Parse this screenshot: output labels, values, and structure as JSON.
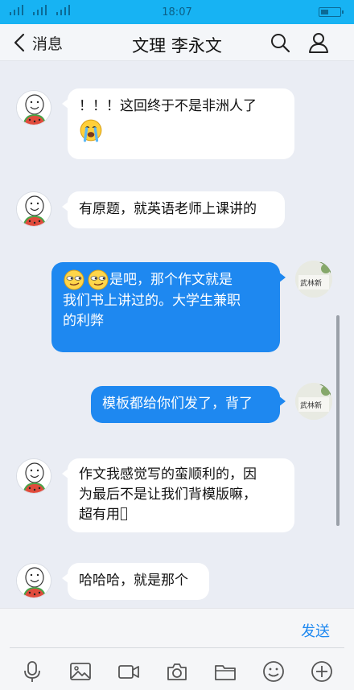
{
  "status_bar": {
    "time": "18:07"
  },
  "header": {
    "back_label": "消息",
    "title": "文理 李永文"
  },
  "messages": [
    {
      "side": "in",
      "text": "！！！这回终于不是非洲人了",
      "emoji": "crying-face-icon"
    },
    {
      "side": "in",
      "text": "有原题，就英语老师上课讲的"
    },
    {
      "side": "out",
      "text_line1": "是吧，那个作文就是",
      "text_line2": "我们书上讲过的。大学生兼职",
      "text_line3": "的利弊",
      "emoji": "smirk-face-icon"
    },
    {
      "side": "out",
      "text": "模板都给你们发了，背了"
    },
    {
      "side": "in",
      "text_line1": "作文我感觉写的蛮顺利的，因",
      "text_line2": "为最后不是让我们背模版嘛，",
      "text_line3": "超有用"
    },
    {
      "side": "in",
      "text": "哈哈哈，就是那个"
    }
  ],
  "avatar_right_text": "武林新",
  "input": {
    "send_label": "发送"
  },
  "colors": {
    "accent": "#1e88f0",
    "status_bar": "#17b3f3",
    "background": "#eaedf4"
  }
}
